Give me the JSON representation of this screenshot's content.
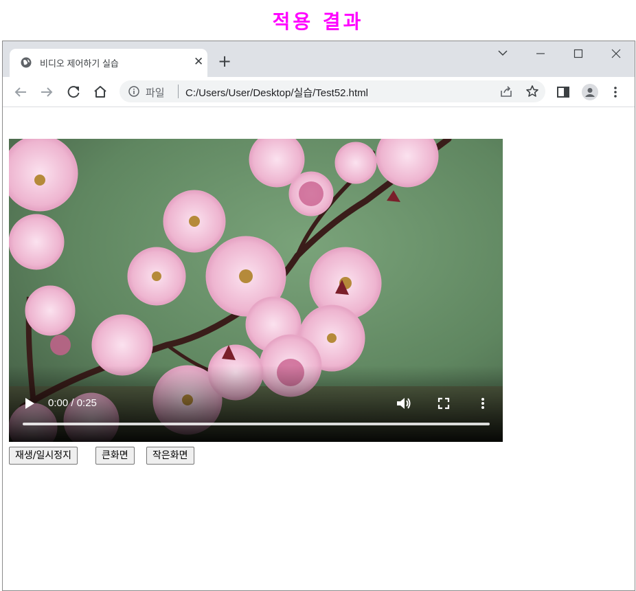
{
  "caption": "적용 결과",
  "browser": {
    "tab_title": "비디오 제어하기 실습",
    "tab_favicon": "globe-icon",
    "new_tab_label": "+",
    "address": {
      "scheme_label": "파일",
      "url": "C:/Users/User/Desktop/실습/Test52.html"
    },
    "icons": [
      "back-icon",
      "forward-icon",
      "reload-icon",
      "home-icon",
      "info-icon",
      "share-icon",
      "star-icon",
      "side-panel-icon",
      "profile-icon",
      "menu-icon",
      "tab-search-icon",
      "minimize-icon",
      "maximize-icon",
      "close-icon"
    ]
  },
  "video": {
    "time_display": "0:00 / 0:25",
    "progress": 0.0,
    "icons": [
      "play-icon",
      "volume-icon",
      "fullscreen-icon",
      "more-options-icon"
    ],
    "colors": {
      "background": "#6b8f6a",
      "petal": "#f3c6dc",
      "petal_dark": "#d98ab2",
      "branch": "#3a1d1a"
    }
  },
  "buttons": {
    "play_pause": "재생/일시정지",
    "big": "큰화면",
    "small": "작은화면"
  }
}
